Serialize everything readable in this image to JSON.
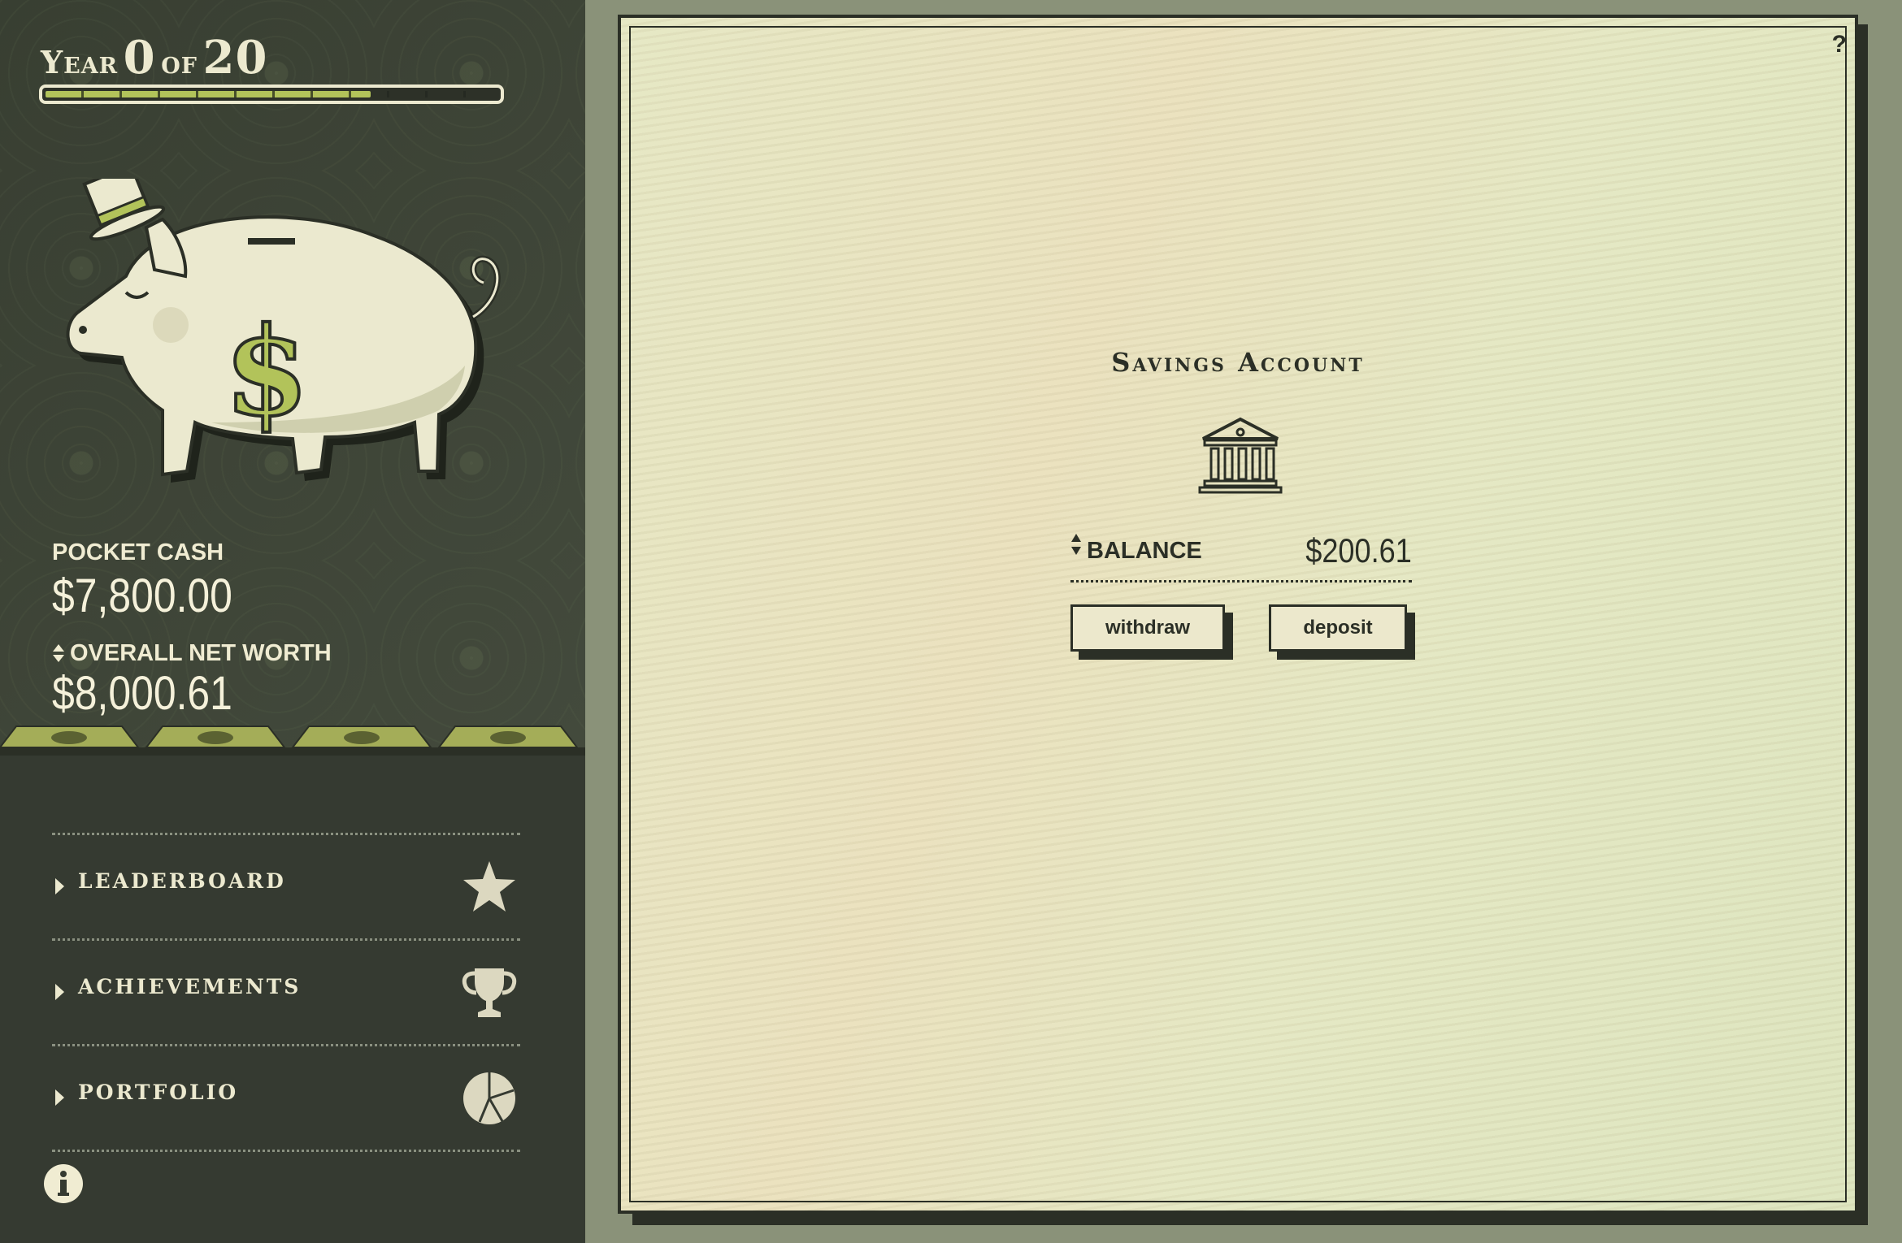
{
  "sidebar": {
    "year": {
      "word": "Year",
      "current": "0",
      "of": "of",
      "total": "20"
    },
    "progress_fraction": 0.72,
    "pocket_cash": {
      "label": "POCKET CASH",
      "value": "$7,800.00"
    },
    "net_worth": {
      "label": "OVERALL NET WORTH",
      "value": "$8,000.61"
    },
    "menu": [
      {
        "label": "Leaderboard",
        "icon": "star-icon"
      },
      {
        "label": "Achievements",
        "icon": "trophy-icon"
      },
      {
        "label": "Portfolio",
        "icon": "pie-chart-icon"
      }
    ]
  },
  "main": {
    "help": "?",
    "title": "Savings Account",
    "balance": {
      "label": "BALANCE",
      "value": "$200.61"
    },
    "buttons": {
      "withdraw": "withdraw",
      "deposit": "deposit"
    }
  },
  "colors": {
    "sidebar_bg": "#353a31",
    "accent_green": "#b2c35a",
    "cream": "#ece9cf",
    "panel_bg": "#e6e8c5",
    "ink": "#2b2f26"
  }
}
